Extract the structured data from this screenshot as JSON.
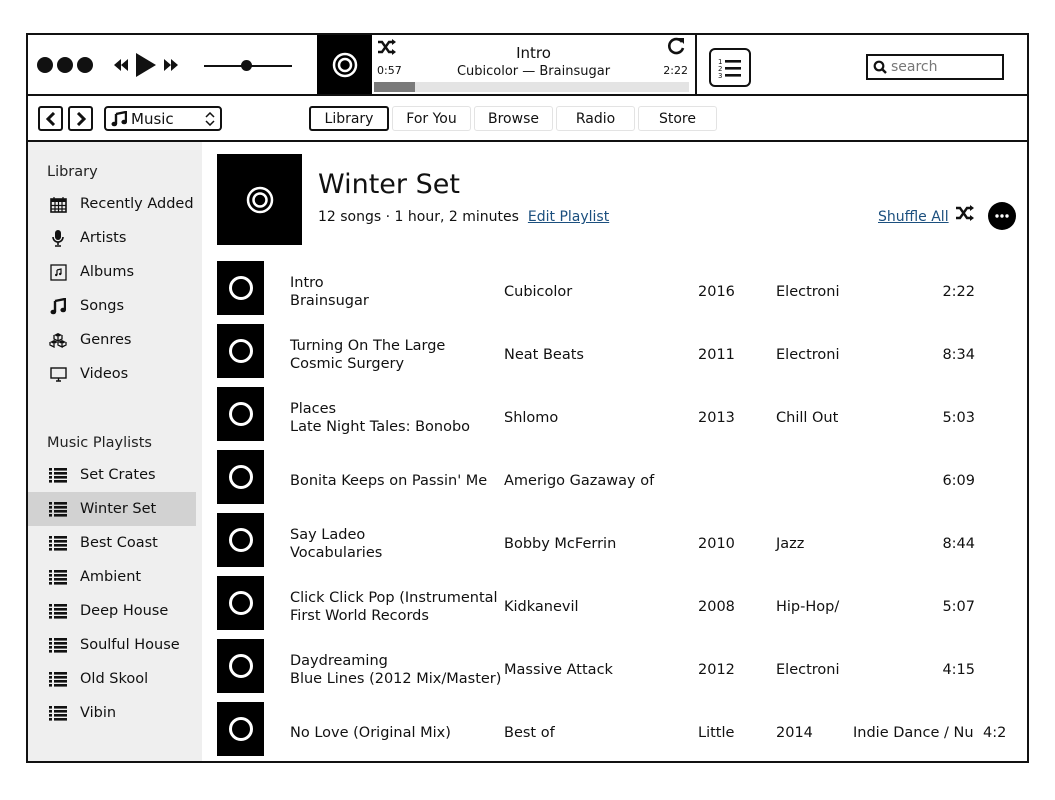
{
  "player": {
    "controls": {
      "prev_icon": "rewind-icon",
      "play_icon": "play-icon",
      "next_icon": "fast-forward-icon"
    },
    "volume_level": 0.48,
    "now_playing": {
      "title": "Intro",
      "subtitle": "Cubicolor — Brainsugar",
      "elapsed": "0:57",
      "total": "2:22",
      "progress_fraction": 0.13,
      "shuffle_icon": "shuffle-icon",
      "repeat_icon": "repeat-icon"
    },
    "queue_icon": "numbered-list-icon",
    "search": {
      "placeholder": "search",
      "value": ""
    }
  },
  "nav": {
    "back_icon": "chevron-left-icon",
    "forward_icon": "chevron-right-icon",
    "source": {
      "label": "Music",
      "icon": "music-note-icon"
    },
    "tabs": [
      {
        "label": "Library",
        "active": true
      },
      {
        "label": "For You",
        "active": false
      },
      {
        "label": "Browse",
        "active": false
      },
      {
        "label": "Radio",
        "active": false
      },
      {
        "label": "Store",
        "active": false
      }
    ]
  },
  "sidebar": {
    "library_heading": "Library",
    "library_items": [
      {
        "label": "Recently Added",
        "icon": "calendar-icon"
      },
      {
        "label": "Artists",
        "icon": "microphone-icon"
      },
      {
        "label": "Albums",
        "icon": "album-icon"
      },
      {
        "label": "Songs",
        "icon": "music-note-icon"
      },
      {
        "label": "Genres",
        "icon": "genres-icon"
      },
      {
        "label": "Videos",
        "icon": "monitor-icon"
      }
    ],
    "playlists_heading": "Music Playlists",
    "playlists": [
      {
        "label": "Set Crates",
        "selected": false
      },
      {
        "label": "Winter Set",
        "selected": true
      },
      {
        "label": "Best Coast",
        "selected": false
      },
      {
        "label": "Ambient",
        "selected": false
      },
      {
        "label": "Deep House",
        "selected": false
      },
      {
        "label": "Soulful House",
        "selected": false
      },
      {
        "label": "Old Skool",
        "selected": false
      },
      {
        "label": "Vibin",
        "selected": false
      }
    ]
  },
  "playlist": {
    "title": "Winter Set",
    "meta": "12 songs · 1 hour, 2 minutes",
    "edit_label": "Edit Playlist",
    "shuffle_all_label": "Shuffle All",
    "more_icon": "more-icon",
    "link_color": "#1b4f7e",
    "tracks": [
      {
        "name": "Intro",
        "album": "Brainsugar",
        "artist": "Cubicolor",
        "year": "2016",
        "genre": "Electroni",
        "time": "2:22"
      },
      {
        "name": "Turning On The Large",
        "album": "Cosmic Surgery",
        "artist": "Neat Beats",
        "year": "2011",
        "genre": "Electroni",
        "time": "8:34"
      },
      {
        "name": "Places",
        "album": "Late Night Tales: Bonobo",
        "artist": "Shlomo",
        "year": "2013",
        "genre": "Chill Out",
        "time": "5:03"
      },
      {
        "name": "Bonita Keeps on Passin' Me",
        "album": "",
        "artist": "Amerigo Gazaway of",
        "year": "",
        "genre": "",
        "time": "6:09"
      },
      {
        "name": "Say Ladeo",
        "album": "Vocabularies",
        "artist": "Bobby McFerrin",
        "year": "2010",
        "genre": "Jazz",
        "time": "8:44"
      },
      {
        "name": "Click Click Pop (Instrumental",
        "album": "First World Records",
        "artist": "Kidkanevil",
        "year": "2008",
        "genre": "Hip-Hop/",
        "time": "5:07"
      },
      {
        "name": "Daydreaming",
        "album": "Blue Lines (2012 Mix/Master)",
        "artist": "Massive Attack",
        "year": "2012",
        "genre": "Electroni",
        "time": "4:15"
      },
      {
        "name": "No Love (Original Mix)",
        "album": "",
        "artist": "Best of",
        "year": "Little",
        "genre": "2014",
        "extra": "Indie Dance / Nu",
        "time2": "4:2",
        "time": ""
      }
    ]
  }
}
